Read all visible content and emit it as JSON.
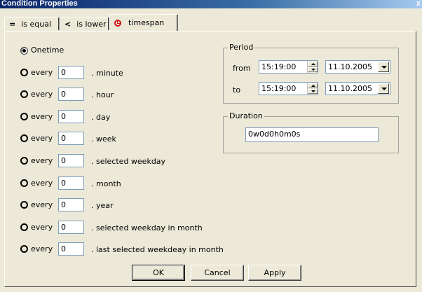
{
  "window": {
    "title": "Condition Properties",
    "close": "x"
  },
  "tabs": [
    {
      "icon": "=",
      "label": "is equal"
    },
    {
      "icon": "<",
      "label": "is lower"
    },
    {
      "icon": "clock-icon",
      "label": "timespan"
    }
  ],
  "frequency": {
    "onetime_label": "Onetime",
    "every_label": "every",
    "rows": [
      {
        "value": "0",
        "unit": ". minute"
      },
      {
        "value": "0",
        "unit": ". hour"
      },
      {
        "value": "0",
        "unit": ". day"
      },
      {
        "value": "0",
        "unit": ". week"
      },
      {
        "value": "0",
        "unit": ". selected weekday"
      },
      {
        "value": "0",
        "unit": ". month"
      },
      {
        "value": "0",
        "unit": ". year"
      },
      {
        "value": "0",
        "unit": ". selected weekday in month"
      },
      {
        "value": "0",
        "unit": ". last selected weekdeay in month"
      }
    ]
  },
  "period": {
    "title": "Period",
    "from_label": "from",
    "to_label": "to",
    "from_time": "15:19:00",
    "from_date": "11.10.2005",
    "to_time": "15:19:00",
    "to_date": "11.10.2005"
  },
  "duration": {
    "title": "Duration",
    "value": "0w0d0h0m0s"
  },
  "buttons": {
    "ok": "OK",
    "cancel": "Cancel",
    "apply": "Apply"
  }
}
